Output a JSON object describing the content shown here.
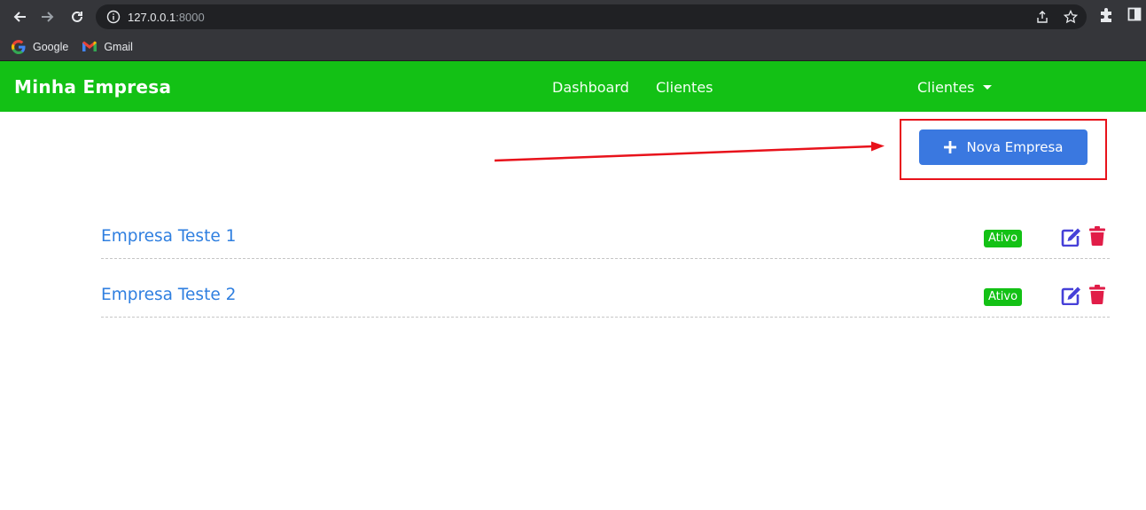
{
  "browser": {
    "url_host": "127.0.0.1",
    "url_port": ":8000",
    "bookmarks": [
      {
        "label": "Google",
        "icon": "google-icon"
      },
      {
        "label": "Gmail",
        "icon": "gmail-icon"
      }
    ]
  },
  "navbar": {
    "brand": "Minha Empresa",
    "links": [
      "Dashboard",
      "Clientes"
    ],
    "dropdown_label": "Clientes",
    "color": "#13c115"
  },
  "toolbar": {
    "new_company_label": "Nova Empresa",
    "new_company_icon": "plus-icon",
    "button_color": "#3a78e0"
  },
  "annotation": {
    "color": "#e8121b"
  },
  "companies": [
    {
      "name": "Empresa Teste 1",
      "status": "Ativo"
    },
    {
      "name": "Empresa Teste 2",
      "status": "Ativo"
    }
  ],
  "colors": {
    "status_active": "#13c115",
    "edit_icon": "#4640d8",
    "delete_icon": "#e11d48",
    "link": "#2f7fe0"
  }
}
